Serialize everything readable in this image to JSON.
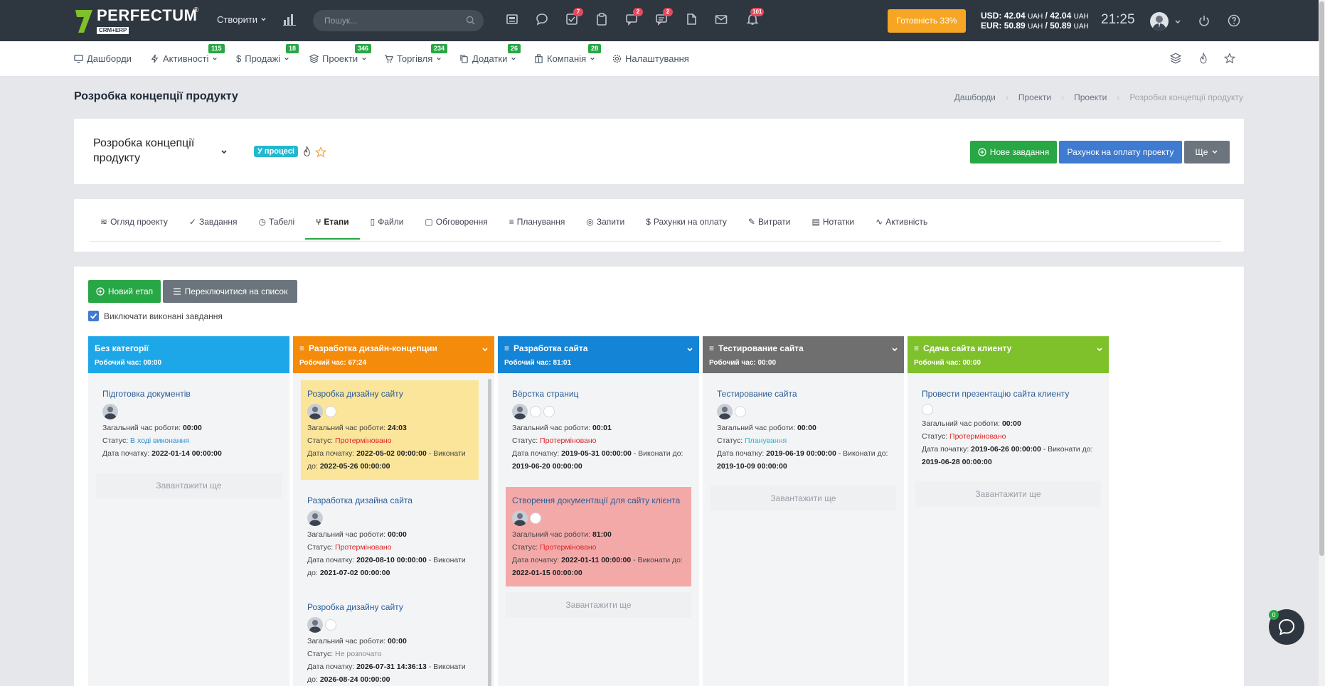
{
  "topbar": {
    "logo_name": "PERFECTUM",
    "logo_sub": "CRM+ERP",
    "logo_reg": "®",
    "create_label": "Створити",
    "search_placeholder": "Пошук...",
    "badges": {
      "tasks": "7",
      "chat": "2",
      "messages": "2",
      "notifications": "101"
    },
    "readiness": "Готовність 33%",
    "usd_label": "USD:",
    "usd_values": "42.04",
    "usd_unit": "UAH",
    "usd_sep": "/",
    "usd_values2": "42.04",
    "eur_label": "EUR:",
    "eur_values": "50.89",
    "eur_values2": "50.89",
    "clock": "21:25"
  },
  "menu": [
    {
      "label": "Дашборди",
      "badge": "",
      "icon": "monitor-icon"
    },
    {
      "label": "Активності",
      "badge": "115",
      "icon": "bolt-icon"
    },
    {
      "label": "Продажі",
      "badge": "18",
      "icon": "dollar-icon"
    },
    {
      "label": "Проекти",
      "badge": "346",
      "icon": "layers-icon"
    },
    {
      "label": "Торгівля",
      "badge": "234",
      "icon": "cart-icon"
    },
    {
      "label": "Додатки",
      "badge": "26",
      "icon": "copy-icon"
    },
    {
      "label": "Компанія",
      "badge": "28",
      "icon": "building-icon"
    },
    {
      "label": "Налаштування",
      "badge": "",
      "icon": "gear-icon"
    }
  ],
  "page": {
    "title": "Розробка концепції продукту",
    "breadcrumb": [
      "Дашборди",
      "Проекти",
      "Проекти",
      "Розробка концепції продукту"
    ]
  },
  "project": {
    "name": "Розробка концепції продукту",
    "status": "У процесі",
    "btn_new_task": "Нове завдання",
    "btn_invoice": "Рахунок на оплату проекту",
    "btn_more": "Ще"
  },
  "tabs": [
    "Огляд проекту",
    "Завдання",
    "Табелі",
    "Етапи",
    "Файли",
    "Обговорення",
    "Планування",
    "Запити",
    "Рахунки на оплату",
    "Витрати",
    "Нотатки",
    "Активність"
  ],
  "board": {
    "btn_new_stage": "Новий етап",
    "btn_switch_list": "Переключитися на список",
    "exclude_done": "Виключати виконані завдання",
    "load_more": "Завантажити ще",
    "labels": {
      "total": "Загальний час роботи:",
      "status": "Статус:",
      "start": "Дата початку:",
      "due": "- Виконати до:"
    },
    "columns": [
      {
        "title": "Без категорії",
        "time": "Робочий час: 00:00",
        "color": "#1ea7e8",
        "tasks": [
          {
            "title": "Підготовка документів",
            "total": "00:00",
            "status": "В ході виконання",
            "status_class": "st-blue",
            "start": "2022-01-14 00:00:00",
            "due": "",
            "bg": ""
          }
        ]
      },
      {
        "title": "Разработка дизайн-концепции",
        "time": "Робочий час: 67:24",
        "color": "#f58b0a",
        "tasks": [
          {
            "title": "Розробка дизайну сайту",
            "total": "24:03",
            "status": "Протерміновано",
            "status_class": "st-red",
            "start": "2022-05-02 00:00:00",
            "due": "2022-05-26 00:00:00",
            "bg": "yellow"
          },
          {
            "title": "Разработка дизайна сайта",
            "total": "00:00",
            "status": "Протерміновано",
            "status_class": "st-red",
            "start": "2020-08-10 00:00:00",
            "due": "2021-07-02 00:00:00",
            "bg": ""
          },
          {
            "title": "Розробка дизайну сайту",
            "total": "00:00",
            "status": "Не розпочато",
            "status_class": "st-gray",
            "start": "2026-07-31 14:36:13",
            "due": "2026-08-24 00:00:00",
            "bg": ""
          }
        ]
      },
      {
        "title": "Разработка сайта",
        "time": "Робочий час: 81:01",
        "color": "#1384d6",
        "tasks": [
          {
            "title": "Вёрстка страниц",
            "total": "00:01",
            "status": "Протерміновано",
            "status_class": "st-red",
            "start": "2019-05-31 00:00:00",
            "due": "2019-06-20 00:00:00",
            "bg": ""
          },
          {
            "title": "Створення документації для сайту клієнта",
            "total": "81:00",
            "status": "Протерміновано",
            "status_class": "st-red",
            "start": "2022-01-11 00:00:00",
            "due": "2022-01-15 00:00:00",
            "bg": "red"
          }
        ]
      },
      {
        "title": "Тестирование сайта",
        "time": "Робочий час: 00:00",
        "color": "#6f6f6f",
        "tasks": [
          {
            "title": "Тестирование сайта",
            "total": "00:00",
            "status": "Планування",
            "status_class": "st-cyan",
            "start": "2019-06-19 00:00:00",
            "due": "2019-10-09 00:00:00",
            "bg": ""
          }
        ]
      },
      {
        "title": "Сдача сайта клиенту",
        "time": "Робочий час: 00:00",
        "color": "#7ec12a",
        "tasks": [
          {
            "title": "Провести презентацію сайта клиенту",
            "total": "00:00",
            "status": "Протерміновано",
            "status_class": "st-red",
            "start": "2019-06-26 00:00:00",
            "due": "2019-06-28 00:00:00",
            "bg": ""
          }
        ]
      }
    ]
  },
  "chat_badge": "0",
  "colors": {
    "topbar": "#2e3640",
    "green": "#28a745",
    "blue": "#3e7bd1",
    "orange": "#f6a623"
  }
}
